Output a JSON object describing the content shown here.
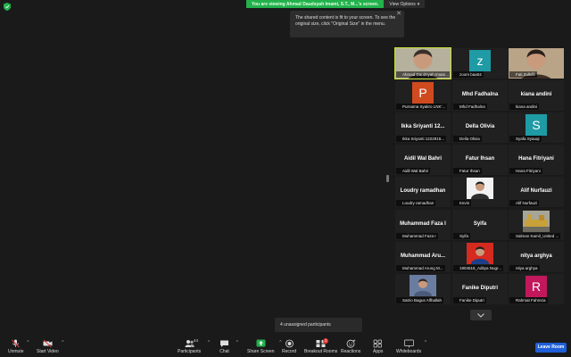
{
  "banner": {
    "viewing_text": "You are viewing Ahmad Daudsyah Imami, S.T., M...'s screen.",
    "view_options_label": "View Options"
  },
  "tooltip": {
    "text": "The shared content is fit to your screen. To see the original size, click \"Original Size\" in the menu."
  },
  "participants": [
    {
      "label": "Ahmad Daudsyah Imam...",
      "center": "",
      "kind": "photo",
      "active": true
    },
    {
      "label": "zoom baa04",
      "center": "",
      "kind": "letter",
      "letter": "z",
      "color": "#1e9ba5"
    },
    {
      "label": "Fati Zulkifli",
      "center": "",
      "kind": "photo"
    },
    {
      "label": "Purnama Syakro LNK'...",
      "center": "",
      "kind": "letter",
      "letter": "P",
      "color": "#d04a1f"
    },
    {
      "label": "Mhd Fadhalna",
      "center": "Mhd Fadhalna",
      "kind": "text"
    },
    {
      "label": "kiana andini",
      "center": "kiana andini",
      "kind": "text"
    },
    {
      "label": "Ikka Sriyanti 1222915...",
      "center": "Ikka Sriyanti 12...",
      "kind": "text"
    },
    {
      "label": "Della Olivia",
      "center": "Della Olivia",
      "kind": "text"
    },
    {
      "label": "Syafa Syauqi",
      "center": "",
      "kind": "letter",
      "letter": "S",
      "color": "#1e9ba5"
    },
    {
      "label": "Aidil Wal Bahri",
      "center": "Aidil Wal Bahri",
      "kind": "text"
    },
    {
      "label": "Fatur Ihsan",
      "center": "Fatur Ihsan",
      "kind": "text"
    },
    {
      "label": "Hana Fitriyani",
      "center": "Hana Fitriyani",
      "kind": "text"
    },
    {
      "label": "Loudry ramadhan",
      "center": "Loudry ramadhan",
      "kind": "text"
    },
    {
      "label": "Kevin",
      "center": "",
      "kind": "photo"
    },
    {
      "label": "Alif Nurfauzi",
      "center": "Alif Nurfauzi",
      "kind": "text"
    },
    {
      "label": "Muhammad Faza I",
      "center": "Muhammad Faza I",
      "kind": "text"
    },
    {
      "label": "Syifa",
      "center": "Syifa",
      "kind": "text"
    },
    {
      "label": "Salman Kamil_United ...",
      "center": "",
      "kind": "photo"
    },
    {
      "label": "Muhammad Arung M...",
      "center": "Muhammad Aru...",
      "kind": "text"
    },
    {
      "label": "1904518_Aditya Nugr...",
      "center": "",
      "kind": "photo"
    },
    {
      "label": "nitya arghya",
      "center": "nitya arghya",
      "kind": "text"
    },
    {
      "label": "Satrio Bagus Alfhallah",
      "center": "",
      "kind": "photo"
    },
    {
      "label": "Fanike Diputri",
      "center": "Fanike Diputri",
      "kind": "text"
    },
    {
      "label": "Rahmat Fahreza",
      "center": "",
      "kind": "letter",
      "letter": "R",
      "color": "#c2185b"
    }
  ],
  "unassigned": "4 unassigned participants",
  "toolbar": {
    "unmute": "Unmute",
    "start_video": "Start Video",
    "participants": "Participants",
    "participant_count": "44",
    "chat": "Chat",
    "share_screen": "Share Screen",
    "record": "Record",
    "breakout_rooms": "Breakout Rooms",
    "breakout_badge": "3",
    "reactions": "Reactions",
    "apps": "Apps",
    "whiteboards": "Whiteboards",
    "leave": "Leave Room"
  },
  "colors": {
    "banner_green": "#22b14c",
    "active_outline": "#c8e23b",
    "leave_blue": "#1f5fd8",
    "muted_red": "#e53935"
  }
}
